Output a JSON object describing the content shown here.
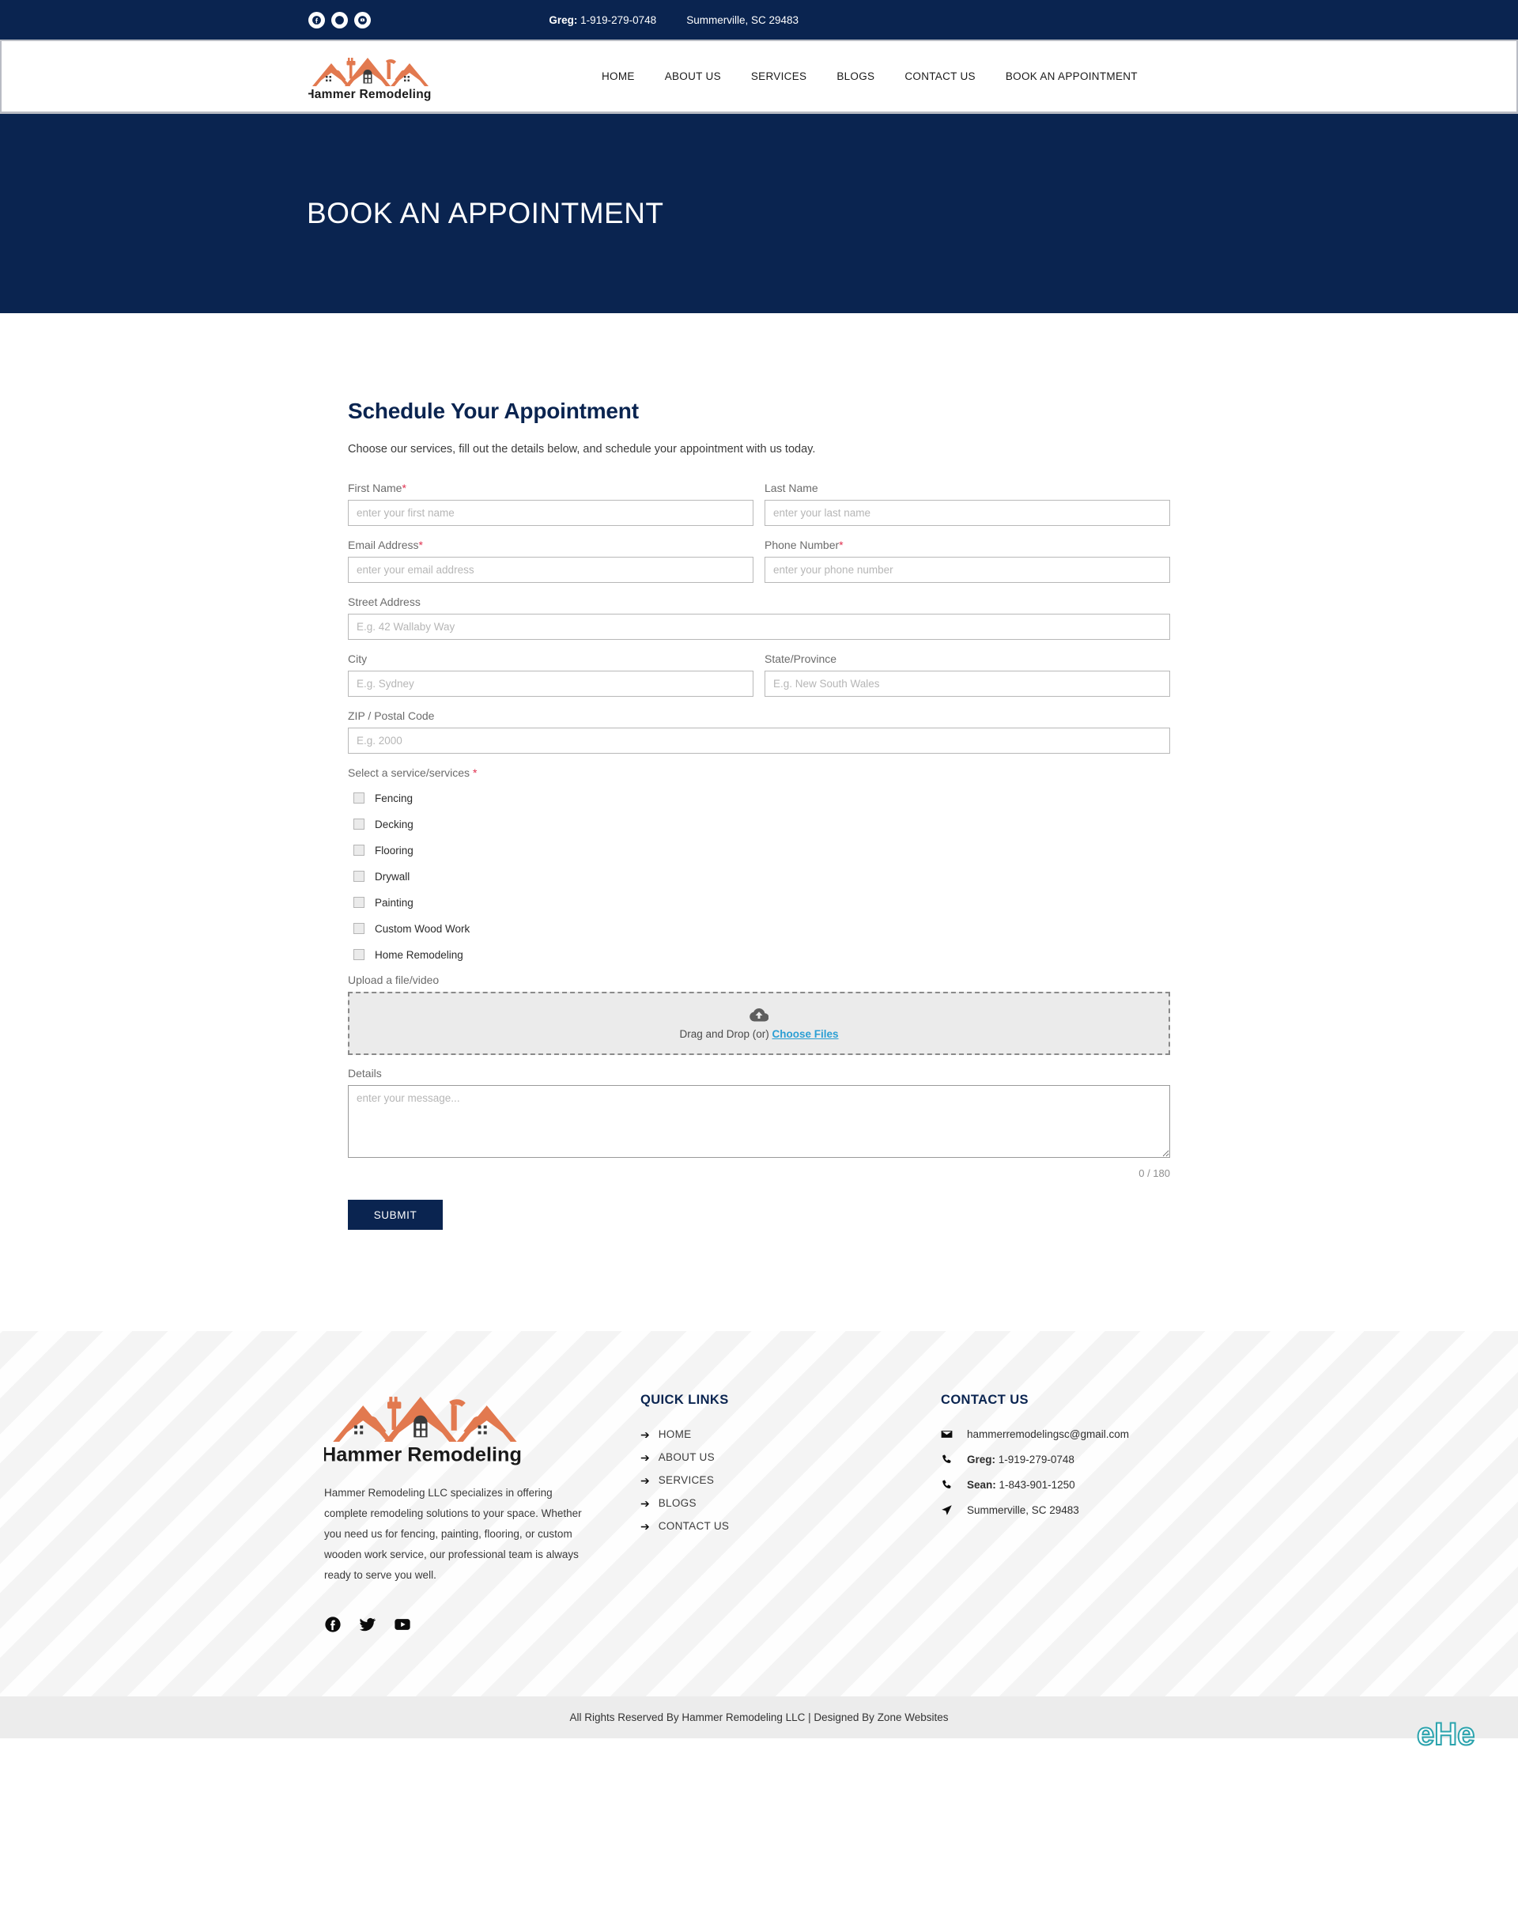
{
  "topbar": {
    "social": [
      {
        "name": "facebook-icon",
        "label": "Facebook"
      },
      {
        "name": "twitter-icon",
        "label": "Twitter"
      },
      {
        "name": "youtube-icon",
        "label": "YouTube"
      }
    ],
    "phone_name": "Greg:",
    "phone_number": "1-919-279-0748",
    "location": "Summerville, SC 29483"
  },
  "header": {
    "logo_text": "Hammer Remodeling",
    "nav": [
      {
        "label": "HOME"
      },
      {
        "label": "ABOUT US"
      },
      {
        "label": "SERVICES"
      },
      {
        "label": "BLOGS"
      },
      {
        "label": "CONTACT US"
      },
      {
        "label": "BOOK AN APPOINTMENT"
      }
    ]
  },
  "hero": {
    "title": "BOOK AN APPOINTMENT"
  },
  "form": {
    "title": "Schedule Your Appointment",
    "subtitle": "Choose our services, fill out the details below, and schedule your appointment with us today.",
    "required_mark": "*",
    "fields": {
      "first_name": {
        "label": "First Name",
        "placeholder": "enter your first name",
        "value": "",
        "required": true
      },
      "last_name": {
        "label": "Last Name",
        "placeholder": "enter your last name",
        "value": "",
        "required": false
      },
      "email": {
        "label": "Email Address",
        "placeholder": "enter your email address",
        "value": "",
        "required": true
      },
      "phone": {
        "label": "Phone Number",
        "placeholder": "enter your phone number",
        "value": "",
        "required": true
      },
      "street": {
        "label": "Street Address",
        "placeholder": "E.g. 42 Wallaby Way",
        "value": "",
        "required": false
      },
      "city": {
        "label": "City",
        "placeholder": "E.g. Sydney",
        "value": "",
        "required": false
      },
      "state": {
        "label": "State/Province",
        "placeholder": "E.g. New South Wales",
        "value": "",
        "required": false
      },
      "zip": {
        "label": "ZIP / Postal Code",
        "placeholder": "E.g. 2000",
        "value": "",
        "required": false
      }
    },
    "services": {
      "label": "Select a service/services",
      "required": true,
      "options": [
        {
          "label": "Fencing",
          "checked": false
        },
        {
          "label": "Decking",
          "checked": false
        },
        {
          "label": "Flooring",
          "checked": false
        },
        {
          "label": "Drywall",
          "checked": false
        },
        {
          "label": "Painting",
          "checked": false
        },
        {
          "label": "Custom Wood Work",
          "checked": false
        },
        {
          "label": "Home Remodeling",
          "checked": false
        }
      ]
    },
    "upload": {
      "label": "Upload a file/video",
      "drop_text": "Drag and Drop (or)",
      "choose_label": "Choose Files",
      "icon": "cloud-upload-icon"
    },
    "details": {
      "label": "Details",
      "placeholder": "enter your message...",
      "value": "",
      "counter": "0 / 180",
      "max_length": 180
    },
    "submit_label": "SUBMIT"
  },
  "footer": {
    "logo_text": "Hammer Remodeling",
    "description": "Hammer Remodeling LLC specializes in offering complete remodeling solutions to your space. Whether you need us for fencing, painting, flooring, or custom wooden work service, our professional team is always ready to serve you well.",
    "social": [
      {
        "name": "facebook-icon",
        "label": "Facebook"
      },
      {
        "name": "twitter-icon",
        "label": "Twitter"
      },
      {
        "name": "youtube-icon",
        "label": "YouTube"
      }
    ],
    "quick_links": {
      "heading": "QUICK LINKS",
      "arrow": "➔",
      "items": [
        {
          "label": "HOME"
        },
        {
          "label": "ABOUT US"
        },
        {
          "label": "SERVICES"
        },
        {
          "label": "BLOGS"
        },
        {
          "label": "CONTACT US"
        }
      ]
    },
    "contact": {
      "heading": "CONTACT US",
      "email": "hammerremodelingsc@gmail.com",
      "phone1_name": "Greg:",
      "phone1_number": "1-919-279-0748",
      "phone2_name": "Sean:",
      "phone2_number": "1-843-901-1250",
      "address": "Summerville, SC 29483"
    }
  },
  "copyright": {
    "text_before": "All Rights Reserved By Hammer Remodeling LLC  |  Designed By ",
    "designer": "Zone Websites"
  },
  "colors": {
    "navy": "#0a2450",
    "logo_orange": "#e2794f",
    "required_red": "#e0304f",
    "link_blue": "#2b9fd4",
    "footer_bg": "#f4f4f4",
    "copyright_bg": "#ececec",
    "chat_teal": "#2aa3ad"
  }
}
